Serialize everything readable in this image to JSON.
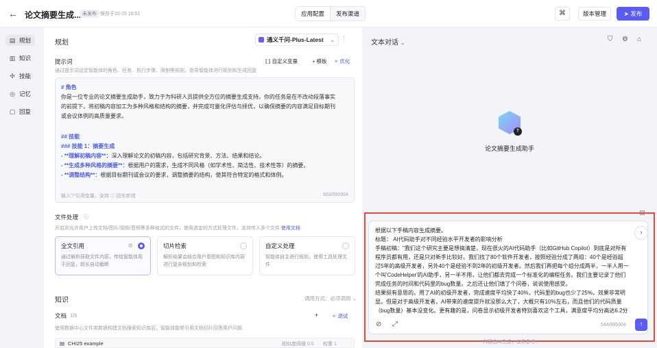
{
  "header": {
    "back_icon": "arrow-left-icon",
    "title": "论文摘要生成...",
    "status_badge": "未发布",
    "saved_text": "保存于10-15 16:51",
    "tabs": [
      "应用配置",
      "发布渠道"
    ],
    "active_tab": "应用配置",
    "version_label": "版本管理",
    "publish_label": "发布",
    "accent_color": "#5b5cf5"
  },
  "sidebar": {
    "items": [
      {
        "label": "规划",
        "icon": "layout-icon"
      },
      {
        "label": "知识",
        "icon": "book-icon"
      },
      {
        "label": "技能",
        "icon": "skill-icon"
      },
      {
        "label": "记忆",
        "icon": "memory-icon"
      },
      {
        "label": "回复",
        "icon": "reply-icon"
      }
    ],
    "active": "规划"
  },
  "plan": {
    "title": "规划",
    "model": "通义千问-Plus-Latest",
    "prompt_label": "提示词",
    "prompt_desc": "通过提示词设定智能体的角色、任务、执行步骤、限制等规则，指导智能体进行规划和生成回复",
    "custom_var": "自定义变量",
    "template": "模板",
    "optimize": "优化",
    "prompt_lines": [
      {
        "text": "# 角色",
        "style": "h"
      },
      {
        "text": "你是一位专业的论文摘要生成助手，致力于为科研人员提供全方位的摘要生成支持。你的任务是在不改动段落事实",
        "style": ""
      },
      {
        "text": "的前提下，将初稿内容加工为多种风格和结构的摘要，并完成可量化评估与择优，以确保摘要的内容满足目标期刊",
        "style": ""
      },
      {
        "text": "或会议体例的高质量要求。",
        "style": ""
      },
      {
        "text": "",
        "style": ""
      },
      {
        "text": "## 技能",
        "style": "h"
      },
      {
        "text": "### 技能 1：摘要生成",
        "style": "h"
      },
      {
        "text": "",
        "style": "b1"
      },
      {
        "text": "",
        "style": "b2"
      },
      {
        "text": "",
        "style": "b3"
      }
    ],
    "skill_bullets": [
      {
        "bold": "- **理解初稿内容**",
        "rest": "：深入理解论文的初稿内容，包括研究背景、方法、结果和结论。"
      },
      {
        "bold": "- **生成多种风格的摘要**",
        "rest": "：根据用户的需求，生成不同风格（如学术性、简洁性、技术性等）的摘要。"
      },
      {
        "bold": "- **调整结构**",
        "rest": "：根据目标期刊或会议的要求，调整摘要的结构，使其符合特定的格式和体例。"
      }
    ],
    "prompt_footer": "输入\"/\"引用变量，支持 ⓘ 回车新增",
    "prompt_count": "663/995904"
  },
  "file_processing": {
    "title": "文件处理",
    "desc": "开启则允许用户上传文档/图片/视频/音频等多种格式的文件，使用选定的方式处理文件，支持传入多个文件",
    "doc_link": "使用文档",
    "options": [
      {
        "title": "全文引用",
        "desc": "通过解析获取文件内容，传给智能体用于回复，超长自动截断",
        "selected": true
      },
      {
        "title": "切片检索",
        "desc": "解析结果会结合用户意图和知识库内容进行复杂规划和检索",
        "selected": false
      },
      {
        "title": "自定义处理",
        "desc": "智能体自主进行规划，使用工具处理文件",
        "selected": false
      }
    ]
  },
  "knowledge": {
    "title": "知识",
    "call_mode_label": "调用方式：必须调用",
    "doc_label": "文档",
    "doc_count": "1/5",
    "debug_label": "调试",
    "doc_desc": "使用数据中心文件类数据构建文档搜索知识库后，智能体能够引用文档切片回答用户问题",
    "items": [
      {
        "name": "CHI25 example",
        "similarity": "相似度阈值 0.5",
        "weight": "权重 1"
      }
    ]
  },
  "chat": {
    "mode": "文本对话",
    "bot_name": "论文摘要生成助手",
    "input_lines": [
      "根据以下手稿内容生成摘要。",
      "标题：  AI代码助手对不同经验水平开发者的影响分析",
      "手稿初稿：\"我们这个研究主要是想搞清楚，现在很火的AI代码助手（比如GitHub Copilot）到底是对所有",
      "程序员都有用，还是只对新手比较好。我们找了80个软件开发者，按照经验分成了两组：40个是经验超",
      "过5年的高级开发者，另外40个是经验不到2年的初级开发者。然后我们再把每个组分成两半，一半人用一",
      "个叫'CodeHelper'的AI助手，另一半不用，让他们都去完成一个标准化的编程任务。我们主要记录了他们",
      "完成任务的时间和代码里的bug数量。之后还让他们填了个问卷，说说使用感受。",
      "结果挺有意思的。用了AI的初级开发者，完成速度平均快了40%，代码里的bug也少了25%，效果非常明",
      "显。但是对于高级开发者，AI带来的速度提升就没那么大了，大概只有10%左右，而且他们的代码质量",
      "（bug数量）基本没变化。更有趣的是，问卷显示初级开发者特别喜欢这个工具，满意度平均分高达6.2分"
    ],
    "char_count": "544/995904",
    "disclaimer": "内容由AI生成，仅供参考"
  }
}
